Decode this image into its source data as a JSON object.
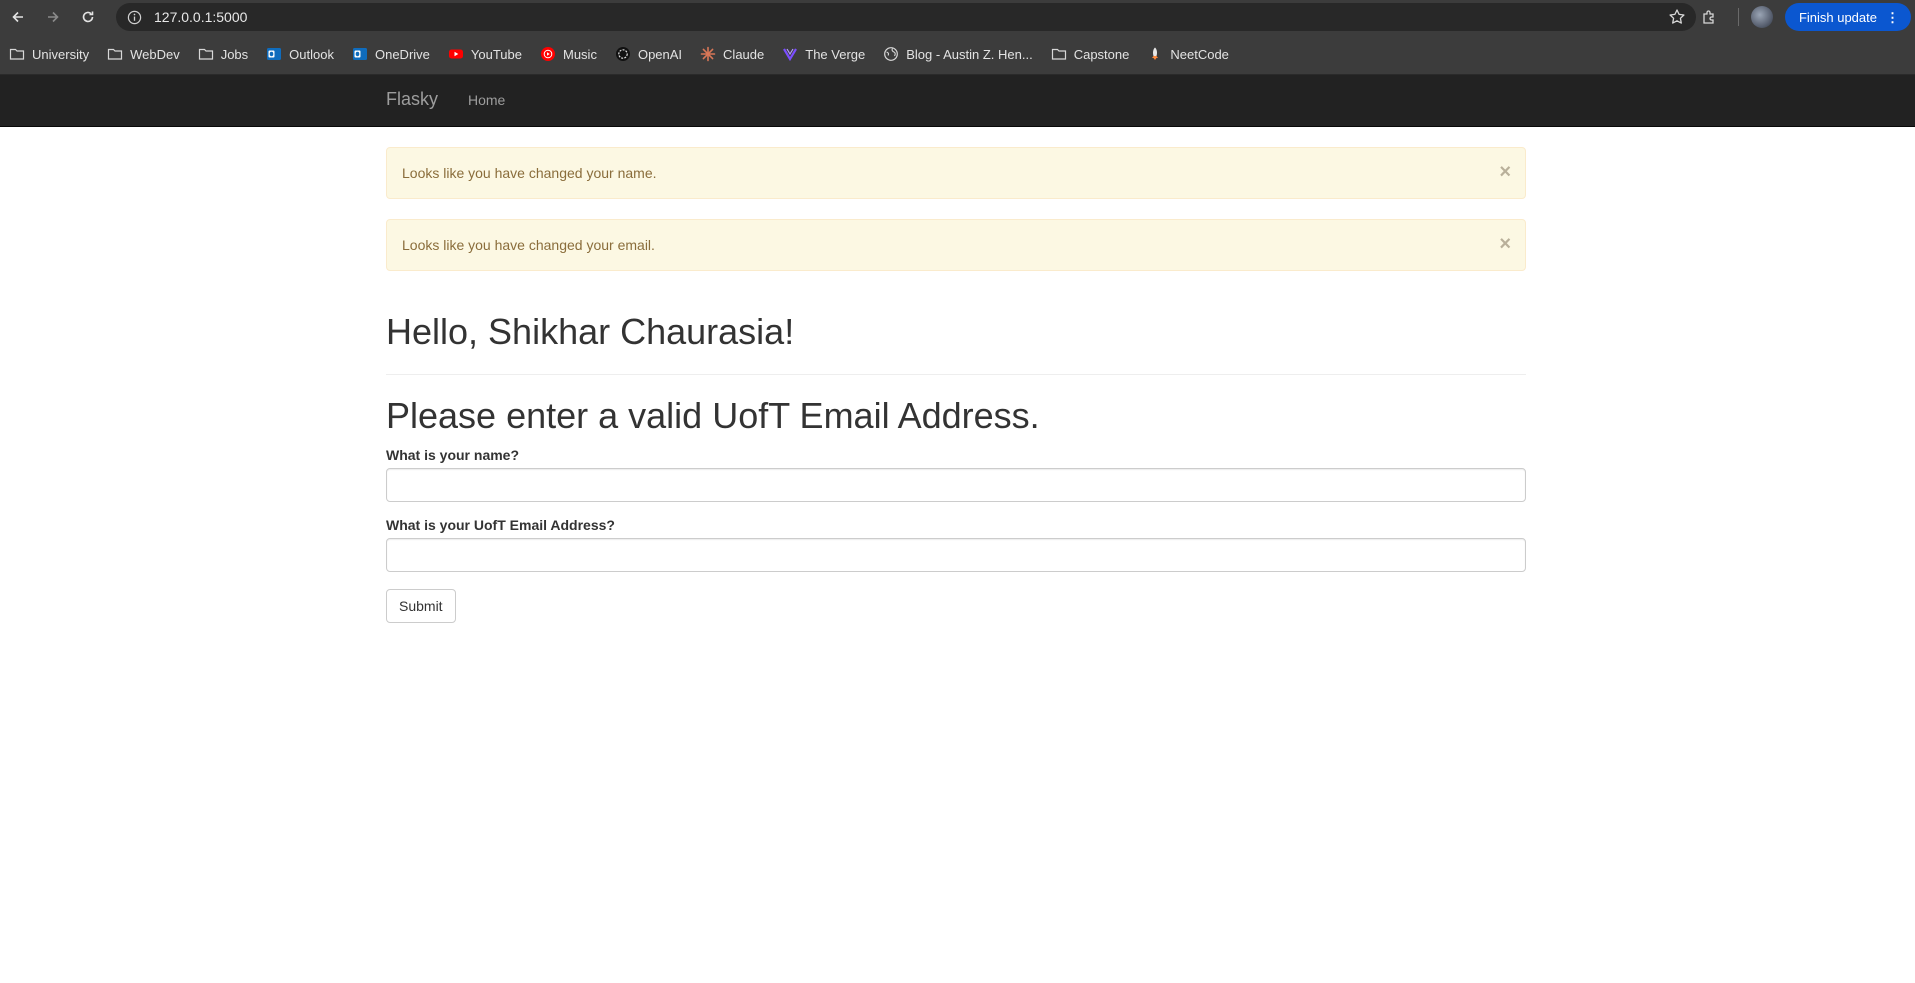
{
  "browser": {
    "url": "127.0.0.1:5000",
    "update_button": "Finish update",
    "bookmarks": [
      {
        "label": "University",
        "icon": "folder-icon"
      },
      {
        "label": "WebDev",
        "icon": "folder-icon"
      },
      {
        "label": "Jobs",
        "icon": "folder-icon"
      },
      {
        "label": "Outlook",
        "icon": "outlook-icon"
      },
      {
        "label": "OneDrive",
        "icon": "outlook-icon"
      },
      {
        "label": "YouTube",
        "icon": "youtube-icon"
      },
      {
        "label": "Music",
        "icon": "youtube-music-icon"
      },
      {
        "label": "OpenAI",
        "icon": "openai-icon"
      },
      {
        "label": "Claude",
        "icon": "claude-icon"
      },
      {
        "label": "The Verge",
        "icon": "verge-icon"
      },
      {
        "label": "Blog - Austin Z. Hen...",
        "icon": "globe-icon"
      },
      {
        "label": "Capstone",
        "icon": "folder-icon"
      },
      {
        "label": "NeetCode",
        "icon": "rocket-icon"
      }
    ]
  },
  "navbar": {
    "brand": "Flasky",
    "home": "Home"
  },
  "alerts": [
    {
      "message": "Looks like you have changed your name.",
      "close": "×"
    },
    {
      "message": "Looks like you have changed your email.",
      "close": "×"
    }
  ],
  "greeting": "Hello, Shikhar Chaurasia!",
  "prompt": "Please enter a valid UofT Email Address.",
  "form": {
    "name_label": "What is your name?",
    "name_value": "",
    "email_label": "What is your UofT Email Address?",
    "email_value": "",
    "submit": "Submit"
  },
  "colors": {
    "navbar_bg": "#222222",
    "alert_bg": "#fcf8e3",
    "alert_text": "#8a6d3b",
    "update_button": "#0b57d0"
  }
}
